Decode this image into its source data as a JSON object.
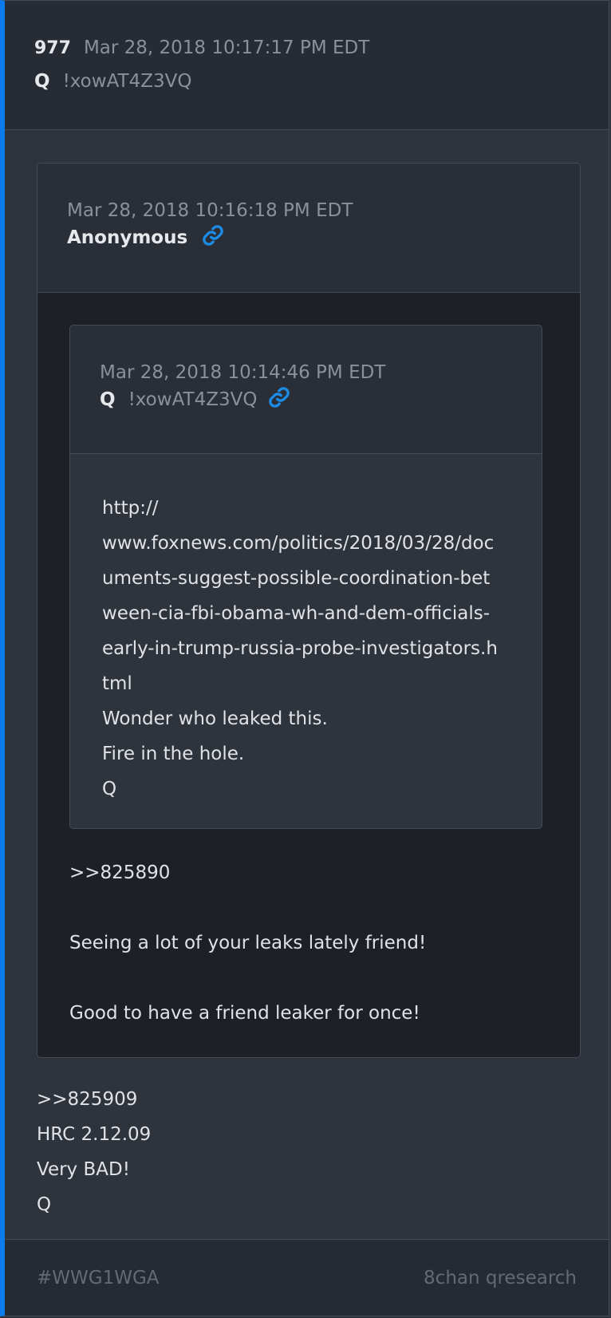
{
  "post": {
    "number": "977",
    "timestamp": "Mar 28, 2018 10:17:17 PM EDT",
    "author": "Q",
    "tripcode": "!xowAT4Z3VQ",
    "body": ">>825909",
    "lines": [
      "HRC 2.12.09",
      "Very BAD!",
      "Q"
    ]
  },
  "quote_anon": {
    "timestamp": "Mar 28, 2018 10:16:18 PM EDT",
    "author": "Anonymous",
    "link_icon": "link-icon",
    "reply_ref": ">>825890",
    "line1": "Seeing a lot of your leaks lately friend!",
    "line2": "Good to have a friend leaker for once!"
  },
  "quote_q": {
    "timestamp": "Mar 28, 2018 10:14:46 PM EDT",
    "author": "Q",
    "tripcode": "!xowAT4Z3VQ",
    "link_icon": "link-icon",
    "url_line1": "http://",
    "url_line2": "www.foxnews.com/politics/2018/03/28/documents-suggest-possible-coordination-between-cia-fbi-obama-wh-and-dem-officials-early-in-trump-russia-probe-investigators.html",
    "line1": "Wonder who leaked this.",
    "line2": "Fire in the hole.",
    "line3": "Q"
  },
  "footer": {
    "hashtag": "#WWG1WGA",
    "source": "8chan qresearch"
  },
  "colors": {
    "accent": "#0a7cf0",
    "link": "#1c8ce6",
    "background": "#2e333c"
  }
}
